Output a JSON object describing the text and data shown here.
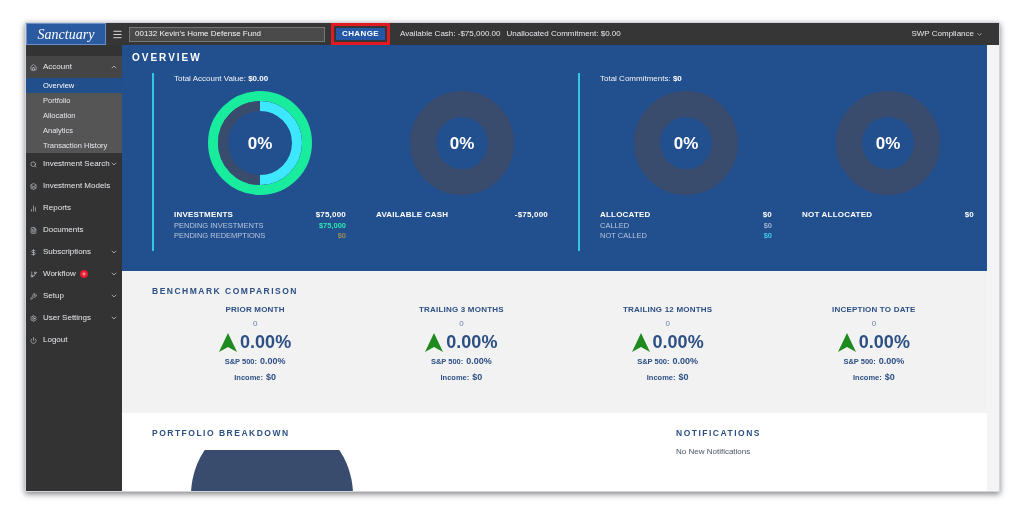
{
  "header": {
    "logo": "Sanctuary",
    "fund_field": {
      "value": "00132 Kevin's Home Defense Fund"
    },
    "change_button": {
      "label": "CHANGE",
      "highlighted": true
    },
    "available_cash": "Available Cash: -$75,000.00",
    "unallocated": "Unallocated Commitment: $0.00",
    "user_menu": "SWP Compliance"
  },
  "sidebar": {
    "items": [
      {
        "label": "Account",
        "expanded": true,
        "has_chevron": true,
        "children": [
          {
            "label": "Overview",
            "selected": true
          },
          {
            "label": "Portfolio",
            "selected": false
          },
          {
            "label": "Allocation",
            "selected": false
          },
          {
            "label": "Analytics",
            "selected": false
          },
          {
            "label": "Transaction History",
            "selected": false
          }
        ]
      },
      {
        "label": "Investment Search",
        "expanded": false,
        "has_chevron": true
      },
      {
        "label": "Investment Models",
        "has_chevron": false
      },
      {
        "label": "Reports",
        "has_chevron": false
      },
      {
        "label": "Documents",
        "has_chevron": false
      },
      {
        "label": "Subscriptions",
        "expanded": false,
        "has_chevron": true
      },
      {
        "label": "Workflow",
        "expanded": false,
        "has_chevron": true,
        "badge": true
      },
      {
        "label": "Setup",
        "expanded": false,
        "has_chevron": true
      },
      {
        "label": "User Settings",
        "expanded": false,
        "has_chevron": true
      },
      {
        "label": "Logout",
        "has_chevron": false
      }
    ]
  },
  "overview": {
    "title": "OVERVIEW",
    "groups": [
      {
        "label": "Total Account Value:",
        "value": "$0.00",
        "donuts": [
          {
            "kind": "split",
            "center": "0%",
            "title": "INVESTMENTS",
            "amount": "$75,000",
            "details": [
              {
                "label": "PENDING INVESTMENTS",
                "value": "$75,000",
                "color": "#2ee6b0"
              },
              {
                "label": "PENDING REDEMPTIONS",
                "value": "$0",
                "color": "#9a8a52"
              }
            ]
          },
          {
            "kind": "empty",
            "center": "0%",
            "title": "AVAILABLE CASH",
            "amount": "-$75,000"
          }
        ]
      },
      {
        "label": "Total Commitments:",
        "value": "$0",
        "donuts": [
          {
            "kind": "empty",
            "center": "0%",
            "title": "ALLOCATED",
            "amount": "$0",
            "details": [
              {
                "label": "CALLED",
                "value": "$0",
                "color": "#9fb0cc"
              },
              {
                "label": "NOT CALLED",
                "value": "$0",
                "color": "#3ec8e8"
              }
            ]
          },
          {
            "kind": "empty",
            "center": "0%",
            "title": "NOT ALLOCATED",
            "amount": "$0"
          }
        ]
      }
    ]
  },
  "benchmark": {
    "title": "BENCHMARK COMPARISON",
    "columns": [
      {
        "title": "PRIOR MONTH",
        "sub": "0",
        "value": "0.00%",
        "sp_label": "S&P 500:",
        "sp_value": "0.00%",
        "income_label": "Income:",
        "income_value": "$0"
      },
      {
        "title": "TRAILING 3 MONTHS",
        "sub": "0",
        "value": "0.00%",
        "sp_label": "S&P 500:",
        "sp_value": "0.00%",
        "income_label": "Income:",
        "income_value": "$0"
      },
      {
        "title": "TRAILING 12 MONTHS",
        "sub": "0",
        "value": "0.00%",
        "sp_label": "S&P 500:",
        "sp_value": "0.00%",
        "income_label": "Income:",
        "income_value": "$0"
      },
      {
        "title": "INCEPTION TO DATE",
        "sub": "0",
        "value": "0.00%",
        "sp_label": "S&P 500:",
        "sp_value": "0.00%",
        "income_label": "Income:",
        "income_value": "$0"
      }
    ]
  },
  "portfolio_breakdown": {
    "title": "PORTFOLIO BREAKDOWN"
  },
  "notifications": {
    "title": "NOTIFICATIONS",
    "message": "No New Notifications"
  }
}
